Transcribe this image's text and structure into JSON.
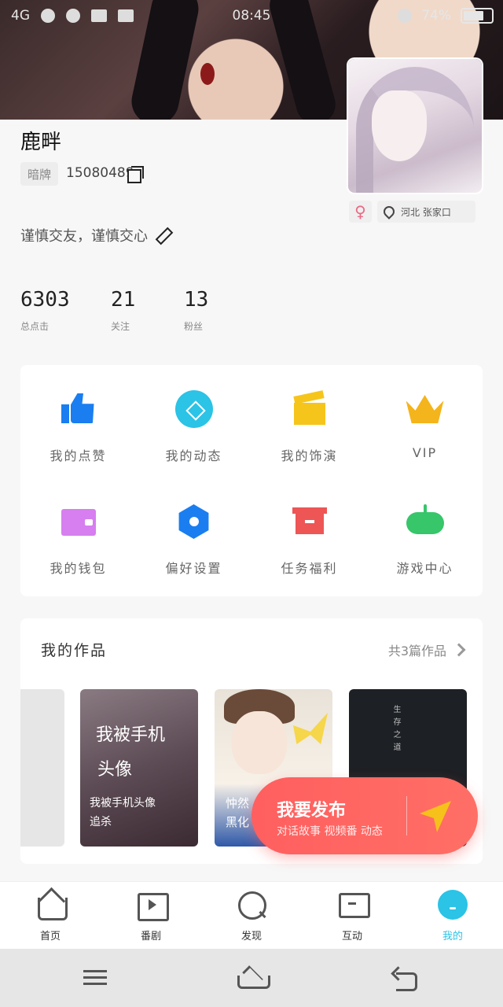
{
  "statusbar": {
    "network": "4G",
    "time": "08:45",
    "battery": "74%",
    "battery_level": 0.74
  },
  "profile": {
    "name": "鹿畔",
    "tag_label": "暗牌",
    "uid": "15080489",
    "gender_symbol": "♀",
    "location": "河北 张家口",
    "bio": "谨慎交友，谨慎交心"
  },
  "stats": [
    {
      "value": "6303",
      "label": "总点击"
    },
    {
      "value": "21",
      "label": "关注"
    },
    {
      "value": "13",
      "label": "粉丝"
    }
  ],
  "grid": {
    "items": [
      {
        "label": "我的点赞",
        "icon": "thumbs-up-icon"
      },
      {
        "label": "我的动态",
        "icon": "compass-icon"
      },
      {
        "label": "我的饰演",
        "icon": "clapperboard-icon"
      },
      {
        "label": "VIP",
        "icon": "crown-icon"
      },
      {
        "label": "我的钱包",
        "icon": "wallet-icon"
      },
      {
        "label": "偏好设置",
        "icon": "hexagon-settings-icon"
      },
      {
        "label": "任务福利",
        "icon": "gift-box-icon"
      },
      {
        "label": "游戏中心",
        "icon": "gamepad-icon"
      }
    ]
  },
  "works": {
    "title": "我的作品",
    "count_label": "共3篇作品",
    "covers": [
      {
        "line1": "我被手机",
        "line2": "头像",
        "line3": "我被手机头像",
        "line4": "追杀"
      },
      {
        "line1": "忡然",
        "line2": "黑化"
      },
      {
        "vertical": "生存之道"
      }
    ]
  },
  "publish": {
    "title": "我要发布",
    "subtitle": "对话故事 视频番 动态"
  },
  "tabs": [
    {
      "label": "首页",
      "icon": "home-icon"
    },
    {
      "label": "番剧",
      "icon": "play-screen-icon"
    },
    {
      "label": "发现",
      "icon": "search-discover-icon"
    },
    {
      "label": "互动",
      "icon": "message-icon"
    },
    {
      "label": "我的",
      "icon": "profile-icon"
    }
  ],
  "colors": {
    "accent": "#2bc3e6",
    "publish": "#ff5f5f",
    "vip": "#f4b41b"
  }
}
